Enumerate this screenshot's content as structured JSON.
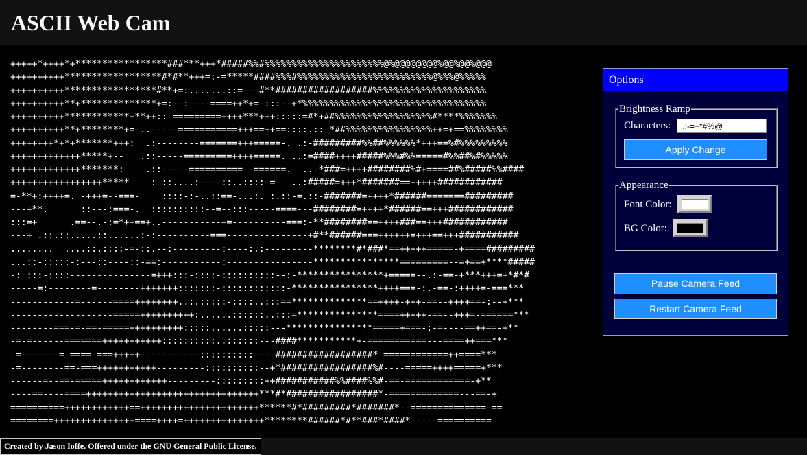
{
  "header": {
    "title": "ASCII Web Cam"
  },
  "ascii_output": {
    "lines": [
      "+++++*++++*+*****************###***+++*#####%%#%%%%%%%%%%%%%%%%%%%%%%@%@@@@@@@@%@@%@@%@@@",
      "++++++++++******************#*#**+++=:-=*****####%%%#%%%%%%%%%%%%%%%%%%%%%%%%%@%%%@%%%%%",
      "++++++++++*****************#**+=:.......::=---#**##################%%%%%%%%%%%%%%%%%%%%%",
      "++++++++++**+**************+=:--:----====++*+=-:::--+*%%%%%%%%%%%%%%%%%%%%%%%%%%%%%%%%%%",
      "++++++++++************+**++::-=========++++***+++:::::=#*+##%%%%%%%%%%%%%%%%%%#****%%%%%%%",
      "++++++++++**+********+=-..-----===========+++==++==::::.::-*##%%%%%%%%%%%%%%%%++=+==%%%%%%%%",
      "++++++++*+*+*******+++:  .:--------=======+++=====-. .:-#########%%##%%%%%%*+++==%#%%%%%%%%%",
      "+++++++++++++*****+--   .::-----=========++++=====. ..:=####++++#####%%%#%%=====#%%##%#%%%%%",
      "+++++++++++++*******:    .::-----==========--======.  ..-*###=++++########%#+====##%#####%%####",
      "+++++++++++++++++*****    :-::....:----::..::::-=-  ..:#####=+++*#######==+++++############",
      "=-**+:++++=. -+++=--===-    ::::-:-..::==-...:. :.::-=.::-#######=++++*######=======#########",
      "---+**.      ::---:===-.  ::::::::::--=--:::-----====---########=++++*######==+++############",
      ":::=+      .==--.-:=*++==+..-----------+=----------===:-**########==++++###==+++############",
      "---+ .::.::.....::......:-:----------===---------------+#**######===++++++=+++==+++###########",
      "........  ....::.::::-=-::.--:---------:----:.:---------********#*###*==+++++=====-+====#########",
      "...::-:::::-:---::----::-==:-----------:----------------****************=========--=+==+****#####",
      "-: :::-::::---------------=+++:::-::::-::::::::::--:-****************+=====--.:-==-+***+++=+*#*#",
      "-----=:--------=--------+++++++:::::::-::::::::::::-****************++++===-:.-==-:++++=-===***",
      "------------=------====++++++++..:.:::::-::::..:::==**************==++++-+++-==--++++==-:--+***",
      "-------------------=====++++++++++:......::::::..:::=***************====+++++-==--+++=-======***",
      "--------===-=-==-=====++++++++++:::::......:::::---****************=====+===-:-=----==++==-+**",
      "-=-=------=======+++++++++++::::::::::..::::::---####***********+-===========---====++===***",
      "-=-------=-====-===+++++-----------::::::::::----##################*-============++====***",
      "-=--------==-===+++++++++++---------::::::::::--+*#################%#----=====++++=====+***",
      "------=--==-=====++++++++++++---------:::::::::++###########%%####%%#-==-============-+**",
      "----==----====++++++++++++++++++++++++++++++++***#*#################*-=============---==-+",
      "==========++++++++++++==++++++++++++++++++++++******#*#########*#######*--==============-==",
      "========+++++++++++++++====++++=+++++++++++++++********######*#**###*####*-----==========",
      "=====+**+**++++++**++++++++++=++++++++++++++***************###*******#*######**-=--======",
      "====+++*+**+**++++=++++++++++==++++++++=+++++++++**************###***********#####=--=-----"
    ]
  },
  "options": {
    "title": "Options",
    "brightness_ramp": {
      "legend": "Brightness Ramp",
      "characters_label": "Characters:",
      "characters_value": " .:-=+*#%@",
      "apply_button": "Apply Change"
    },
    "appearance": {
      "legend": "Appearance",
      "font_color_label": "Font Color:",
      "font_color": "#ffffff",
      "bg_color_label": "BG Color:",
      "bg_color": "#000000"
    },
    "pause_button": "Pause Camera Feed",
    "restart_button": "Restart Camera Feed"
  },
  "footer": {
    "credit": "Created by Jason Ioffe. Offered under the GNU General Public License."
  },
  "colors": {
    "page_background": "#000000",
    "header_background": "#121212",
    "panel_background": "#00003d",
    "panel_title_background": "#0000ff",
    "button_background": "#1f8fff"
  }
}
